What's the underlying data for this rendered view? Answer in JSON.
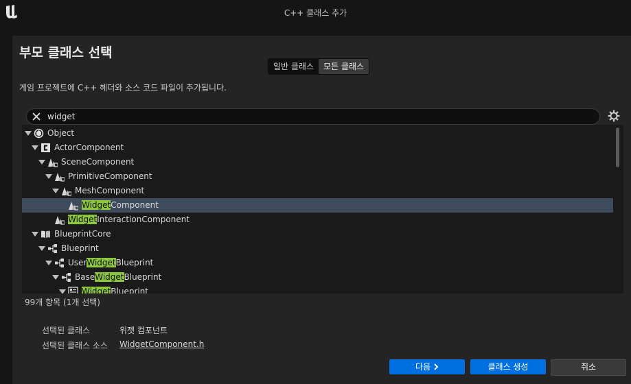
{
  "window": {
    "title": "C++ 클래스 추가"
  },
  "heading": "부모 클래스 선택",
  "mode_toggle": {
    "options": [
      "일반 클래스",
      "모든 클래스"
    ],
    "active_index": 1
  },
  "description": "게임 프로젝트에 C++ 헤더와 소스 코드 파일이 추가됩니다.",
  "search": {
    "value": "widget"
  },
  "tree": {
    "highlight": "Widget",
    "rows": [
      {
        "label": "Object",
        "depth": 0,
        "icon": "object-icon",
        "expanded": true
      },
      {
        "label": "ActorComponent",
        "depth": 1,
        "icon": "cpp-class-icon",
        "expanded": true
      },
      {
        "label": "SceneComponent",
        "depth": 2,
        "icon": "scene-component-icon",
        "expanded": true
      },
      {
        "label": "PrimitiveComponent",
        "depth": 3,
        "icon": "scene-component-icon",
        "expanded": true
      },
      {
        "label": "MeshComponent",
        "depth": 4,
        "icon": "scene-component-icon",
        "expanded": true
      },
      {
        "label": "WidgetComponent",
        "depth": 5,
        "icon": "scene-component-icon",
        "expanded": false,
        "selected": true
      },
      {
        "label": "WidgetInteractionComponent",
        "depth": 3,
        "icon": "scene-component-icon",
        "expanded": false
      },
      {
        "label": "BlueprintCore",
        "depth": 1,
        "icon": "book-icon",
        "expanded": true
      },
      {
        "label": "Blueprint",
        "depth": 2,
        "icon": "blueprint-icon",
        "expanded": true
      },
      {
        "label": "UserWidgetBlueprint",
        "depth": 3,
        "icon": "blueprint-icon",
        "expanded": true
      },
      {
        "label": "BaseWidgetBlueprint",
        "depth": 4,
        "icon": "blueprint-icon",
        "expanded": true
      },
      {
        "label": "WidgetBlueprint",
        "depth": 5,
        "icon": "widget-blueprint-icon",
        "expanded": true
      }
    ]
  },
  "item_count": "99개 항목 (1개 선택)",
  "selected_info": {
    "class_label": "선택된 클래스",
    "class_value": "위젯 컴포넌트",
    "source_label": "선택된 클래스 소스",
    "source_value": "WidgetComponent.h"
  },
  "buttons": {
    "next": "다음",
    "create": "클래스 생성",
    "cancel": "취소"
  },
  "colors": {
    "highlight": "#8dc63f",
    "primary": "#0070e0",
    "selection": "#3d4b5c"
  }
}
